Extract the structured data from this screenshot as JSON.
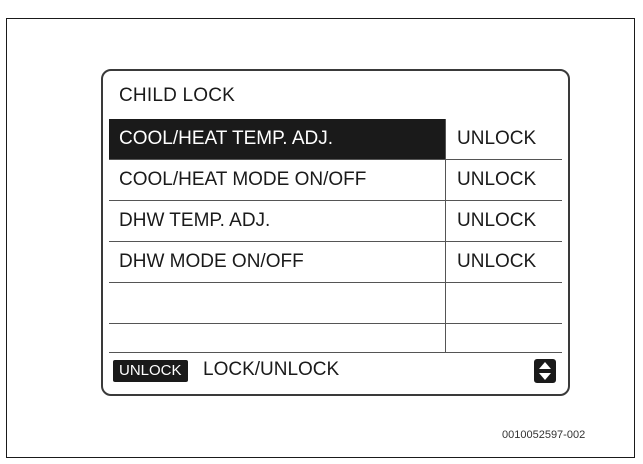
{
  "screen": {
    "title": "CHILD LOCK",
    "rows": [
      {
        "label": "COOL/HEAT TEMP. ADJ.",
        "value": "UNLOCK"
      },
      {
        "label": "COOL/HEAT MODE ON/OFF",
        "value": "UNLOCK"
      },
      {
        "label": "DHW TEMP. ADJ.",
        "value": "UNLOCK"
      },
      {
        "label": "DHW MODE ON/OFF",
        "value": "UNLOCK"
      },
      {
        "label": "",
        "value": ""
      },
      {
        "label": "",
        "value": ""
      }
    ],
    "selected_row": 0,
    "footer": {
      "key_label": "UNLOCK",
      "hint": "LOCK/UNLOCK",
      "scroll_icon": "up-down-arrows-icon"
    }
  },
  "document_code": "0010052597-002",
  "colors": {
    "selection": "#1a1a1a",
    "text": "#1a1a1a",
    "background": "#ffffff"
  }
}
